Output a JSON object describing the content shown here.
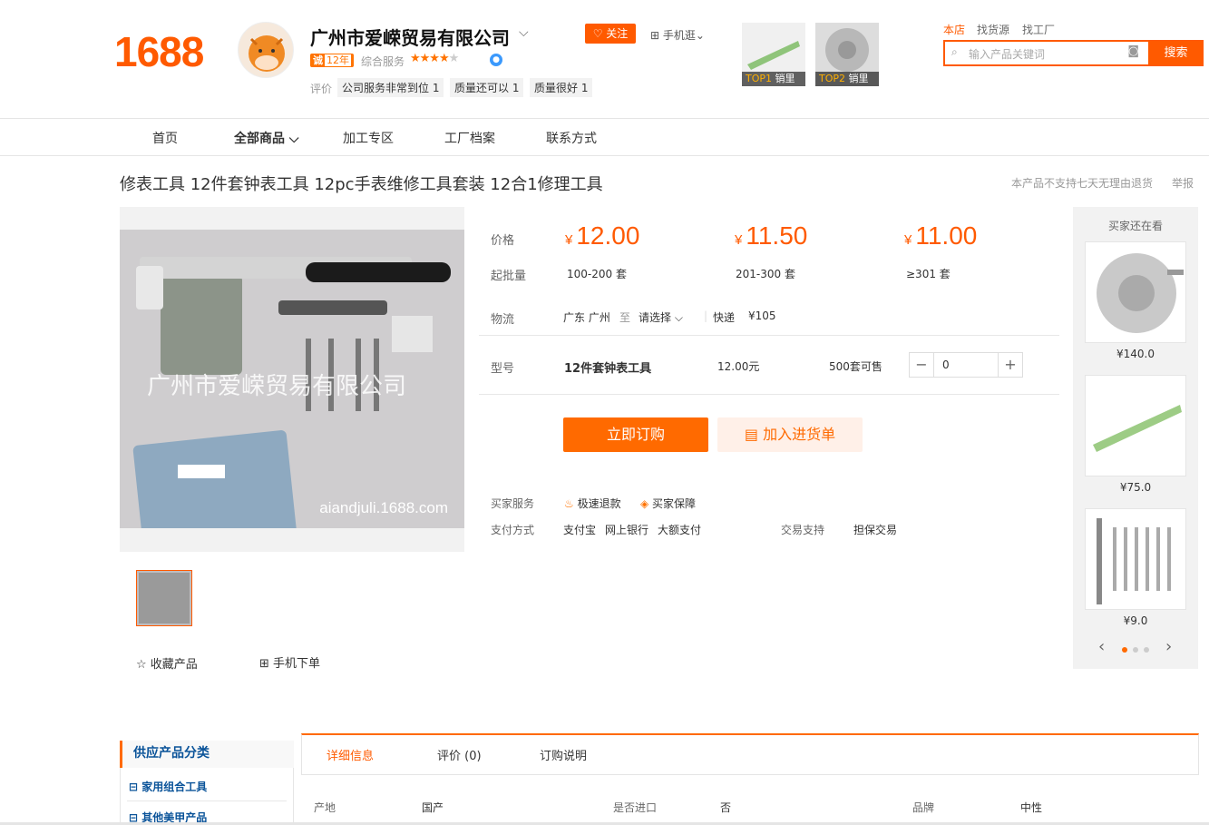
{
  "header": {
    "logo": "1688",
    "company": "广州市爱嵘贸易有限公司",
    "chevron": "⌵",
    "badge_prefix": "诚",
    "badge_years": "12年",
    "service_label": "综合服务",
    "stars": "★★★★",
    "stars_off": "★",
    "vbadge": "●",
    "eval_label": "评价",
    "eval_tags": [
      {
        "text": "公司服务非常到位 1"
      },
      {
        "text": "质量还可以 1"
      },
      {
        "text": "质量很好 1"
      }
    ],
    "follow": "♡ 关注",
    "mobile": "⊞ 手机逛⌄",
    "top1_rank": "TOP1",
    "top1_cap": "销里",
    "top2_rank": "TOP2",
    "top2_cap": "销里",
    "search_tabs": [
      "本店",
      "找货源",
      "找工厂"
    ],
    "search_placeholder": "输入产品关键词",
    "search_button": "搜索"
  },
  "nav": {
    "items": [
      "首页",
      "全部商品 ⌵",
      "加工专区",
      "工厂档案",
      "联系方式"
    ]
  },
  "product": {
    "title": "修表工具 12件套钟表工具 12pc手表维修工具套装 12合1修理工具",
    "no_return_note": "本产品不支持七天无理由退货",
    "report": "举报",
    "watermark": "广州市爱嵘贸易有限公司",
    "watermark_url": "aiandjuli.1688.com",
    "fav": "☆  收藏产品",
    "mobile_order": "⊞  手机下单"
  },
  "pricing": {
    "price_label": "价格",
    "currency": "¥",
    "prices": [
      "12.00",
      "11.50",
      "11.00"
    ],
    "moq_label": "起批量",
    "moq": [
      "100-200 套",
      "201-300 套",
      "≥301 套"
    ],
    "logistics_label": "物流",
    "from": "广东 广州",
    "to_word": "至",
    "select": "请选择  ⌵",
    "express": "快递",
    "fee": "¥105",
    "model_label": "型号",
    "model_name": "12件套钟表工具",
    "model_price": "12.00元",
    "model_stock": "500套可售",
    "qty": "0",
    "minus": "−",
    "plus": "+",
    "buy_now": "立即订购",
    "add_cart": "加入进货单",
    "buyer_service_label": "买家服务",
    "service1": "极速退款",
    "service2": "买家保障",
    "pay_label": "支付方式",
    "pay_methods": [
      "支付宝",
      "网上银行",
      "大额支付"
    ],
    "trade_label": "交易支持",
    "trade_value": "担保交易"
  },
  "sidebar": {
    "title": "买家还在看",
    "items": [
      {
        "price": "¥140.0"
      },
      {
        "price": "¥75.0"
      },
      {
        "price": "¥9.0"
      }
    ],
    "prev": "‹",
    "next": "›"
  },
  "categories": {
    "title": "供应产品分类",
    "items": [
      "⊟ 家用组合工具",
      "⊟ 其他美甲产品"
    ]
  },
  "detail_tabs": [
    "详细信息",
    "评价 (0)",
    "订购说明"
  ],
  "attributes": [
    {
      "k": "产地",
      "v": "国产"
    },
    {
      "k": "是否进口",
      "v": "否"
    },
    {
      "k": "品牌",
      "v": "中性"
    }
  ],
  "colors": {
    "accent": "#ff5a00",
    "link": "#0a5399"
  }
}
